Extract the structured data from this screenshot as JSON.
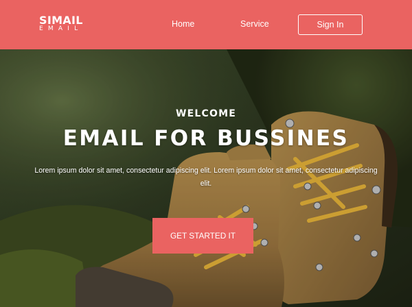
{
  "header": {
    "logo_main": "SIMAIL",
    "logo_sub": "EMAIL",
    "nav": [
      {
        "label": "Home"
      },
      {
        "label": "Service"
      }
    ],
    "signin_label": "Sign In"
  },
  "hero": {
    "welcome": "WELCOME",
    "headline": "EMAIL FOR BUSSINES",
    "description": "Lorem ipsum dolor sit amet, consectetur adipiscing elit. Lorem ipsum dolor sit amet, consectetur adipiscing elit.",
    "cta_label": "GET STARTED IT",
    "background": "photo of worn leather hiking boots on mossy ground"
  },
  "colors": {
    "accent": "#ea6361",
    "text": "#ffffff"
  }
}
